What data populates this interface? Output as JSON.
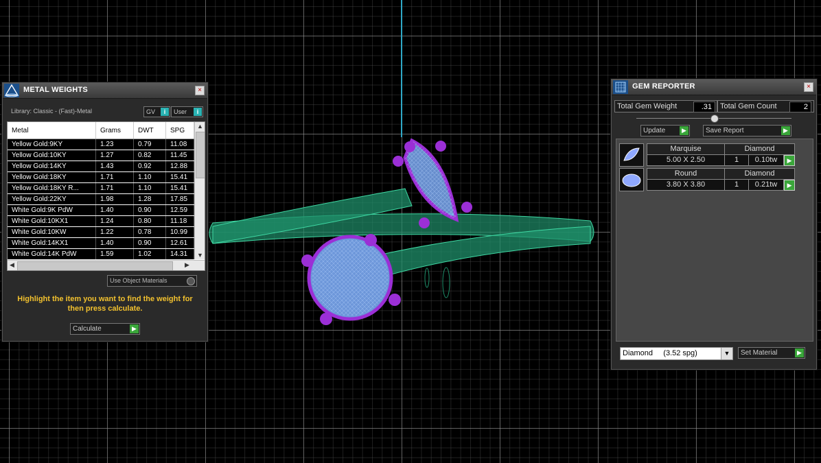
{
  "metal_weights": {
    "title": "METAL WEIGHTS",
    "library": "Library: Classic - (Fast)-Metal",
    "gv_label": "GV",
    "user_label": "User",
    "info_glyph": "i",
    "columns": [
      "Metal",
      "Grams",
      "DWT",
      "SPG"
    ],
    "rows": [
      [
        "Yellow Gold:9KY",
        "1.23",
        "0.79",
        "11.08"
      ],
      [
        "Yellow Gold:10KY",
        "1.27",
        "0.82",
        "11.45"
      ],
      [
        "Yellow Gold:14KY",
        "1.43",
        "0.92",
        "12.88"
      ],
      [
        "Yellow Gold:18KY",
        "1.71",
        "1.10",
        "15.41"
      ],
      [
        "Yellow Gold:18KY R...",
        "1.71",
        "1.10",
        "15.41"
      ],
      [
        "Yellow Gold:22KY",
        "1.98",
        "1.28",
        "17.85"
      ],
      [
        "White Gold:9K PdW",
        "1.40",
        "0.90",
        "12.59"
      ],
      [
        "White Gold:10KX1",
        "1.24",
        "0.80",
        "11.18"
      ],
      [
        "White Gold:10KW",
        "1.22",
        "0.78",
        "10.99"
      ],
      [
        "White Gold:14KX1",
        "1.40",
        "0.90",
        "12.61"
      ],
      [
        "White Gold:14K PdW",
        "1.59",
        "1.02",
        "14.31"
      ]
    ],
    "use_object_materials": "Use Object Materials",
    "hint": "Highlight the item you want to find the weight for then press calculate.",
    "calculate_label": "Calculate"
  },
  "gem_reporter": {
    "title": "GEM REPORTER",
    "total_weight_label": "Total Gem Weight",
    "total_weight_value": ".31",
    "total_count_label": "Total Gem Count",
    "total_count_value": "2",
    "update_label": "Update",
    "save_report_label": "Save Report",
    "gems": [
      {
        "shape": "Marquise",
        "material": "Diamond",
        "size": "5.00 X 2.50",
        "count": "1",
        "weight": "0.10tw"
      },
      {
        "shape": "Round",
        "material": "Diamond",
        "size": "3.80 X 3.80",
        "count": "1",
        "weight": "0.21tw"
      }
    ],
    "material_select": "Diamond     (3.52 spg)",
    "set_material_label": "Set Material"
  },
  "colors": {
    "background": "#000000",
    "grid": "#969696",
    "axis": "#2fa8c6",
    "band": "#1f8f6a",
    "prongs": "#9b2fd6",
    "gem": "#7fb0ff",
    "hint_text": "#f2c12e",
    "go_button": "#3aa63a"
  },
  "icons": {
    "close": "close-icon",
    "go": "play-arrow-icon",
    "metal_panel": "pyramid-icon",
    "gem_panel": "gem-grid-icon",
    "dropdown": "chevron-down-icon"
  }
}
